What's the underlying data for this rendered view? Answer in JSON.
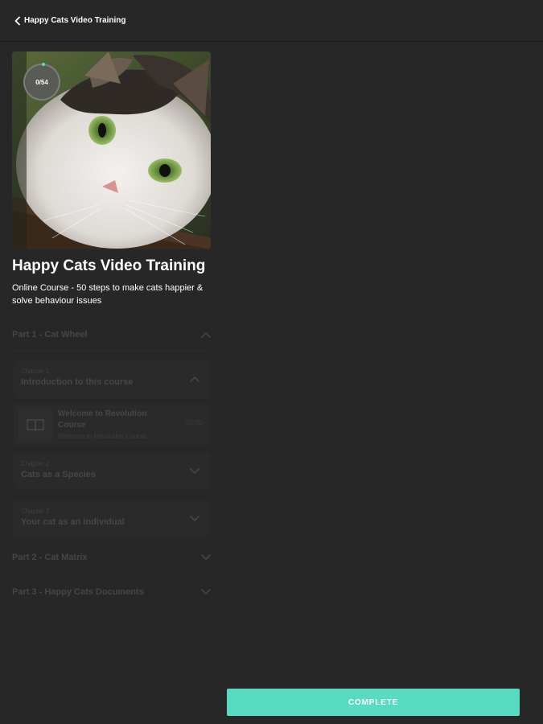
{
  "header": {
    "title": "Happy Cats Video Training",
    "back_icon": "chevron-left-icon"
  },
  "hero": {
    "image_subject": "close-up photo of a white and tabby cat with green eyes",
    "progress_label": "0/54"
  },
  "course": {
    "title": "Happy Cats Video Training",
    "subtitle": "Online Course - 50 steps to make cats happier & solve behaviour issues"
  },
  "parts": [
    {
      "label": "Part 1 - Cat Wheel",
      "expanded": true,
      "chapters": [
        {
          "label": "Chapter 1",
          "title": "Introduction to this course",
          "expanded": true,
          "lessons": [
            {
              "title": "Welcome to Revolution Course",
              "subtitle": "Welcome to Revolution Course",
              "duration": "02:00",
              "icon": "book-icon"
            }
          ]
        },
        {
          "label": "Chapter 2",
          "title": "Cats as a Species",
          "expanded": false
        },
        {
          "label": "Chapter 3",
          "title": "Your cat as an individual",
          "expanded": false
        }
      ]
    },
    {
      "label": "Part 2 - Cat Matrix",
      "expanded": false
    },
    {
      "label": "Part 3 - Happy Cats Documents",
      "expanded": false
    }
  ],
  "actions": {
    "complete_label": "COMPLETE"
  },
  "colors": {
    "background": "#272727",
    "accent": "#57dcc1",
    "muted_text": "#464646",
    "card": "#2a2a2a"
  }
}
